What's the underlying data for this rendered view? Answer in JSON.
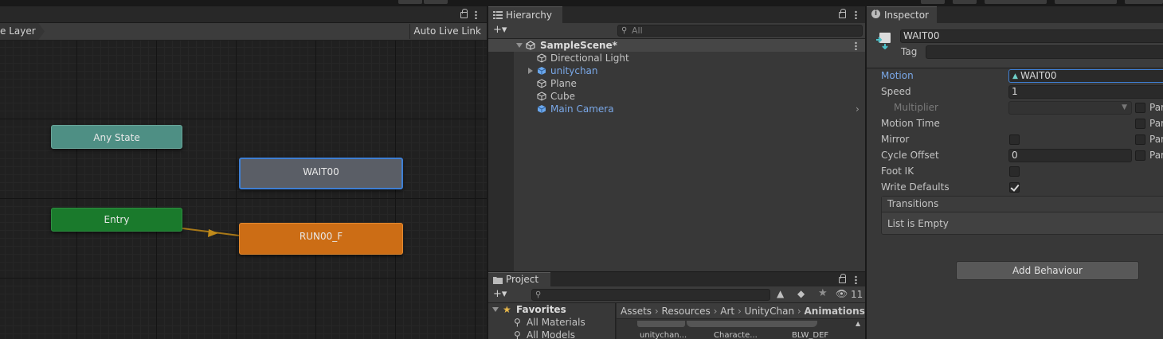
{
  "animator": {
    "layer_breadcrumb": "e Layer",
    "auto_live_link": "Auto Live Link",
    "states": {
      "any_state": "Any State",
      "wait": "WAIT00",
      "entry": "Entry",
      "run": "RUN00_F"
    }
  },
  "hierarchy": {
    "tab": "Hierarchy",
    "add_label": "+▾",
    "search_placeholder": "All",
    "scene": "SampleScene*",
    "items": [
      {
        "label": "Directional Light",
        "icon": "gameobject-icon"
      },
      {
        "label": "unitychan",
        "icon": "prefab-icon"
      },
      {
        "label": "Plane",
        "icon": "gameobject-icon"
      },
      {
        "label": "Cube",
        "icon": "gameobject-icon"
      },
      {
        "label": "Main Camera",
        "icon": "prefab-icon"
      }
    ]
  },
  "project": {
    "tab": "Project",
    "add_label": "+▾",
    "hidden_count": "11",
    "favorites": "Favorites",
    "favorite_items": [
      "All Materials",
      "All Models"
    ],
    "breadcrumbs": [
      "Assets",
      "Resources",
      "Art",
      "UnityChan",
      "Animations"
    ],
    "assets": [
      "unitychan...",
      "Characte...",
      "BLW_DEF"
    ]
  },
  "inspector": {
    "tab": "Inspector",
    "name": "WAIT00",
    "tag_label": "Tag",
    "properties": {
      "motion_label": "Motion",
      "motion_value": "WAIT00",
      "speed_label": "Speed",
      "speed_value": "1",
      "multiplier_label": "Multiplier",
      "motion_time_label": "Motion Time",
      "mirror_label": "Mirror",
      "cycle_offset_label": "Cycle Offset",
      "cycle_offset_value": "0",
      "foot_ik_label": "Foot IK",
      "write_defaults_label": "Write Defaults",
      "param_label": "Par"
    },
    "mirror_checked": false,
    "foot_ik_checked": false,
    "write_defaults_checked": true,
    "transitions_title": "Transitions",
    "transitions_empty": "List is Empty",
    "add_behaviour": "Add Behaviour"
  },
  "colors": {
    "any_state": "#4e8f84",
    "entry": "#1a7a2c",
    "run": "#cc6d15",
    "selected_outline": "#3e7fd4",
    "link": "#7aa8e8"
  }
}
